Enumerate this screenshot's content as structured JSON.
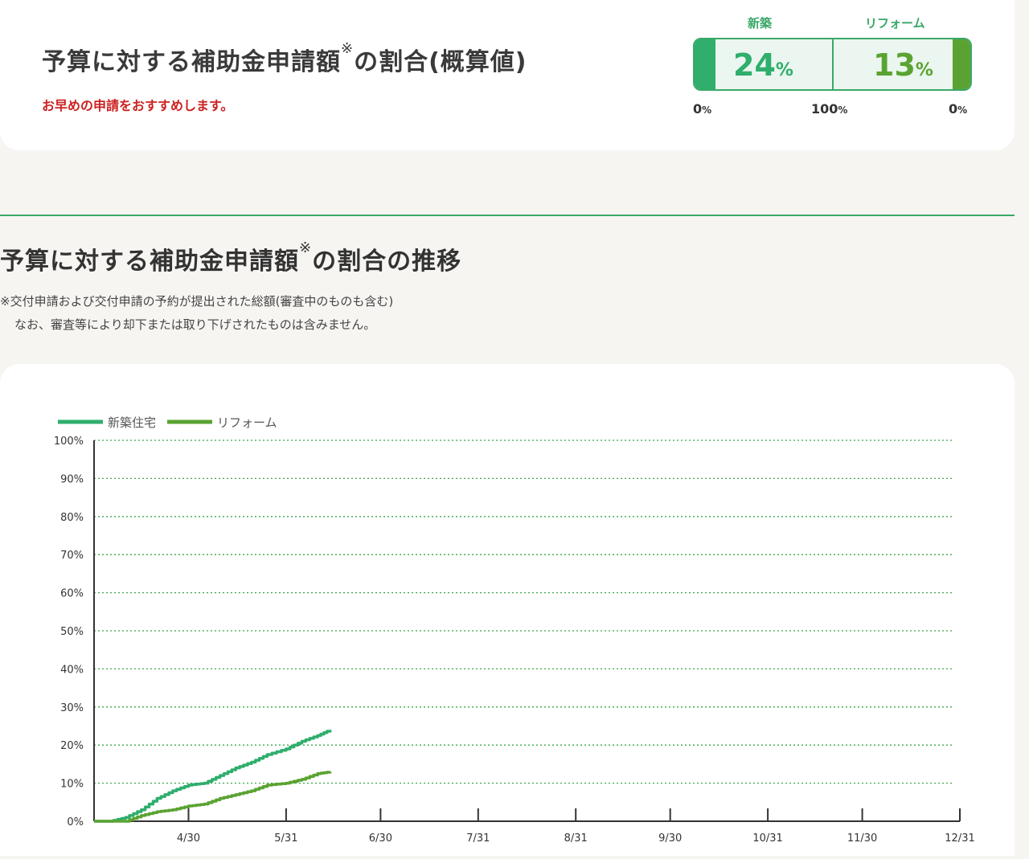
{
  "summary": {
    "title": "予算に対する補助金申請額",
    "title_mark": "※",
    "title_suffix": "の割合(概算値)",
    "note": "お早めの申請をおすすめします。",
    "gauge": {
      "new_label": "新築",
      "reform_label": "リフォーム",
      "new_value": "24",
      "reform_value": "13",
      "pct_unit": "%",
      "new_fraction": 0.24,
      "reform_fraction": 0.13,
      "scale_left": "0",
      "scale_mid": "100",
      "scale_right": "0",
      "new_color": "#2fae6c",
      "reform_color": "#5aa332"
    }
  },
  "trend": {
    "title": "予算に対する補助金申請額",
    "title_mark": "※",
    "title_suffix": "の割合の推移",
    "footnote_1": "※交付申請および交付申請の予約が提出された総額(審査中のものも含む)",
    "footnote_2": "なお、審査等により却下または取り下げされたものは含みません。"
  },
  "chart_data": {
    "type": "line",
    "title": "",
    "xlabel": "",
    "ylabel": "",
    "ylim": [
      0,
      100
    ],
    "y_ticks": [
      "0%",
      "10%",
      "20%",
      "30%",
      "40%",
      "50%",
      "60%",
      "70%",
      "80%",
      "90%",
      "100%"
    ],
    "x_ticks": [
      "4/30",
      "5/31",
      "6/30",
      "7/31",
      "8/31",
      "9/30",
      "10/31",
      "11/30",
      "12/31"
    ],
    "grid": "horizontal dotted",
    "legend_position": "top-left",
    "series": [
      {
        "name": "新築住宅",
        "color": "#2fae6c",
        "points": [
          [
            "3/31",
            0
          ],
          [
            "4/5",
            0
          ],
          [
            "4/10",
            1
          ],
          [
            "4/15",
            3
          ],
          [
            "4/20",
            6
          ],
          [
            "4/25",
            8
          ],
          [
            "4/30",
            9.5
          ],
          [
            "5/5",
            10
          ],
          [
            "5/10",
            12
          ],
          [
            "5/15",
            14
          ],
          [
            "5/20",
            15.5
          ],
          [
            "5/25",
            17.5
          ],
          [
            "5/31",
            19
          ],
          [
            "6/5",
            21
          ],
          [
            "6/10",
            22.5
          ],
          [
            "6/14",
            24
          ]
        ]
      },
      {
        "name": "リフォーム",
        "color": "#5aa332",
        "points": [
          [
            "3/31",
            0
          ],
          [
            "4/5",
            0
          ],
          [
            "4/10",
            0
          ],
          [
            "4/15",
            1.5
          ],
          [
            "4/20",
            2.5
          ],
          [
            "4/25",
            3
          ],
          [
            "4/30",
            4
          ],
          [
            "5/5",
            4.5
          ],
          [
            "5/10",
            6
          ],
          [
            "5/15",
            7
          ],
          [
            "5/20",
            8
          ],
          [
            "5/25",
            9.5
          ],
          [
            "5/31",
            10
          ],
          [
            "6/5",
            11
          ],
          [
            "6/10",
            12.5
          ],
          [
            "6/14",
            13
          ]
        ]
      }
    ]
  }
}
